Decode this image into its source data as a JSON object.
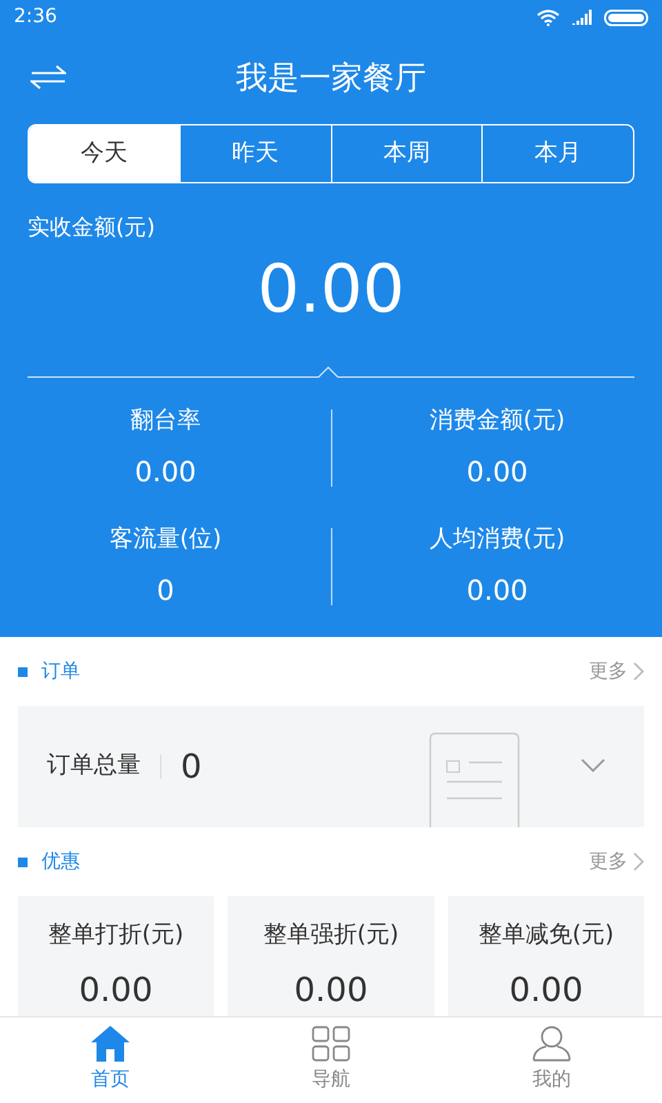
{
  "status_bar": {
    "time": "2:36"
  },
  "header": {
    "title": "我是一家餐厅"
  },
  "tabs": [
    {
      "label": "今天",
      "selected": true
    },
    {
      "label": "昨天",
      "selected": false
    },
    {
      "label": "本周",
      "selected": false
    },
    {
      "label": "本月",
      "selected": false
    }
  ],
  "revenue": {
    "label": "实收金额(元)",
    "value": "0.00"
  },
  "stats": [
    {
      "label": "翻台率",
      "value": "0.00"
    },
    {
      "label": "消费金额(元)",
      "value": "0.00"
    },
    {
      "label": "客流量(位)",
      "value": "0"
    },
    {
      "label": "人均消费(元)",
      "value": "0.00"
    }
  ],
  "orders": {
    "title": "订单",
    "more": "更多",
    "label": "订单总量",
    "value": "0"
  },
  "discounts": {
    "title": "优惠",
    "more": "更多",
    "cards": [
      {
        "label": "整单打折(元)",
        "value": "0.00"
      },
      {
        "label": "整单强折(元)",
        "value": "0.00"
      },
      {
        "label": "整单减免(元)",
        "value": "0.00"
      }
    ]
  },
  "nav": [
    {
      "label": "首页",
      "selected": true,
      "kind": "home"
    },
    {
      "label": "导航",
      "selected": false,
      "kind": "grid"
    },
    {
      "label": "我的",
      "selected": false,
      "kind": "user"
    }
  ]
}
